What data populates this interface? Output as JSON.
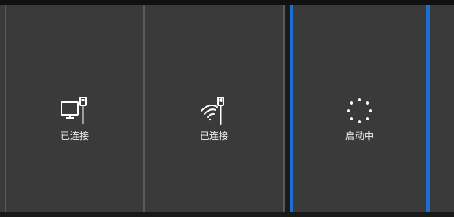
{
  "tiles": [
    {
      "icon": "ethernet-connected-icon",
      "label": "已连接"
    },
    {
      "icon": "wifi-connected-icon",
      "label": "已连接"
    },
    {
      "icon": "loading-spinner-icon",
      "label": "启动中"
    }
  ],
  "colors": {
    "tile_background": "#3a3a3a",
    "selected_border": "#1c6fd1",
    "divider": "#5a5a5a",
    "text": "#f2f2f2"
  }
}
